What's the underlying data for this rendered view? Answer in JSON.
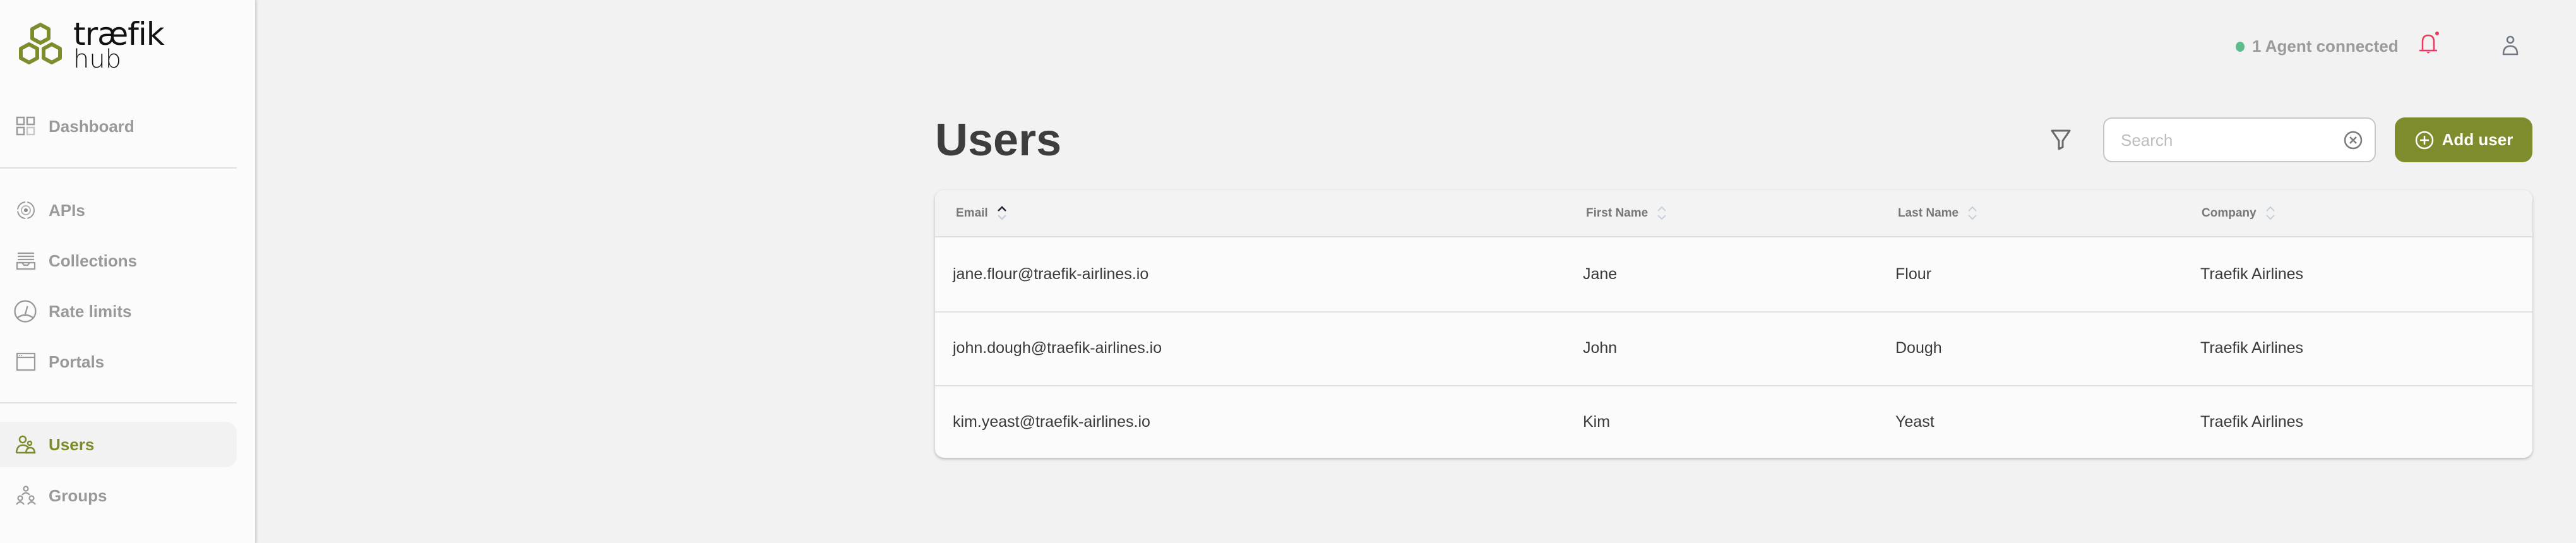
{
  "brand": {
    "name": "træfik",
    "product": "hub",
    "accent_color": "#7f8c2d"
  },
  "sidebar": {
    "items": [
      {
        "label": "Dashboard",
        "icon": "grid-icon",
        "active": false
      },
      {
        "label": "APIs",
        "icon": "api-target-icon",
        "active": false
      },
      {
        "label": "Collections",
        "icon": "collections-tray-icon",
        "active": false
      },
      {
        "label": "Rate limits",
        "icon": "gauge-icon",
        "active": false
      },
      {
        "label": "Portals",
        "icon": "browser-window-icon",
        "active": false
      },
      {
        "label": "Users",
        "icon": "users-icon",
        "active": true
      },
      {
        "label": "Groups",
        "icon": "groups-icon",
        "active": false
      }
    ]
  },
  "topbar": {
    "agent_status": "1 Agent connected",
    "status_color": "#5cbd8b",
    "notification_badge": true
  },
  "page": {
    "title": "Users",
    "search_placeholder": "Search",
    "search_value": "",
    "add_button_label": "Add user"
  },
  "table": {
    "columns": [
      {
        "label": "Email",
        "sort": "asc"
      },
      {
        "label": "First Name",
        "sort": "none"
      },
      {
        "label": "Last Name",
        "sort": "none"
      },
      {
        "label": "Company",
        "sort": "none"
      }
    ],
    "rows": [
      {
        "email": "jane.flour@traefik-airlines.io",
        "first_name": "Jane",
        "last_name": "Flour",
        "company": "Traefik Airlines"
      },
      {
        "email": "john.dough@traefik-airlines.io",
        "first_name": "John",
        "last_name": "Dough",
        "company": "Traefik Airlines"
      },
      {
        "email": "kim.yeast@traefik-airlines.io",
        "first_name": "Kim",
        "last_name": "Yeast",
        "company": "Traefik Airlines"
      }
    ]
  }
}
